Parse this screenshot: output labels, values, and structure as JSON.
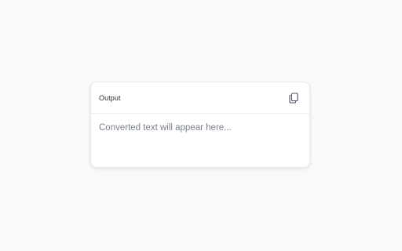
{
  "output_card": {
    "title": "Output",
    "copy_icon": "copy-icon",
    "placeholder": "Converted text will appear here..."
  },
  "colors": {
    "background": "#f8f9fb",
    "card": "#ffffff",
    "title_text": "#2a2f38",
    "placeholder_text": "#7b818d",
    "icon": "#4b5160"
  }
}
